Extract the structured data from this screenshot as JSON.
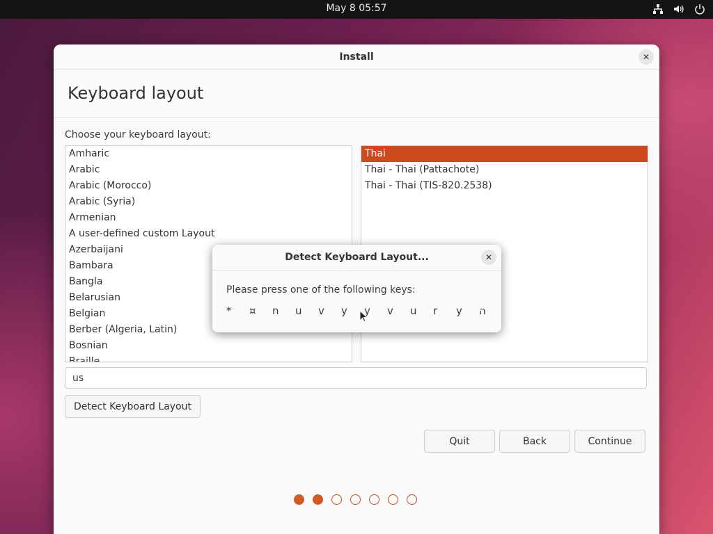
{
  "topbar": {
    "clock": "May 8  05:57",
    "tray_icons": [
      "network-icon",
      "volume-icon",
      "power-icon"
    ]
  },
  "window": {
    "title": "Install",
    "heading": "Keyboard layout",
    "prompt": "Choose your keyboard layout:",
    "layouts": [
      "Amharic",
      "Arabic",
      "Arabic (Morocco)",
      "Arabic (Syria)",
      "Armenian",
      "A user-defined custom Layout",
      "Azerbaijani",
      "Bambara",
      "Bangla",
      "Belarusian",
      "Belgian",
      "Berber (Algeria, Latin)",
      "Bosnian",
      "Braille"
    ],
    "variants": [
      {
        "label": "Thai",
        "selected": true
      },
      {
        "label": "Thai - Thai (Pattachote)",
        "selected": false
      },
      {
        "label": "Thai - Thai (TIS-820.2538)",
        "selected": false
      }
    ],
    "test_field_value": "us",
    "detect_button": "Detect Keyboard Layout",
    "quit_button": "Quit",
    "back_button": "Back",
    "continue_button": "Continue",
    "progress": {
      "total_steps": 7,
      "completed_steps": 2
    }
  },
  "dialog": {
    "title": "Detect Keyboard Layout...",
    "prompt": "Please press one of the following keys:",
    "keys": [
      "*",
      "¤",
      "n",
      "u",
      "v",
      "y",
      "y",
      "v",
      "u",
      "r",
      "y",
      "ה"
    ]
  },
  "colors": {
    "accent": "#cc4a1e",
    "topbar": "#141414"
  }
}
